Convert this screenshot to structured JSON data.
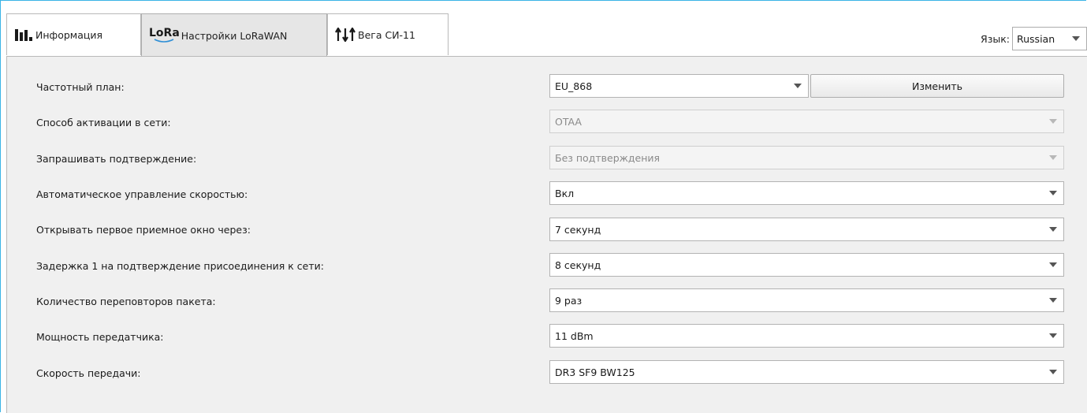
{
  "tabs": [
    {
      "label": "Информация",
      "icon": "bar-chart-icon"
    },
    {
      "label": "Настройки LoRaWAN",
      "icon": "lora-icon",
      "icon_text": "LoRa"
    },
    {
      "label": "Вега СИ-11",
      "icon": "arrows-settings-icon"
    }
  ],
  "language": {
    "label": "Язык:",
    "value": "Russian"
  },
  "change_button": "Изменить",
  "settings": [
    {
      "label": "Частотный план:",
      "value": "EU_868"
    },
    {
      "label": "Способ активации в сети:",
      "value": "OTAA"
    },
    {
      "label": "Запрашивать подтверждение:",
      "value": "Без подтверждения"
    },
    {
      "label": "Автоматическое управление скоростью:",
      "value": "Вкл"
    },
    {
      "label": "Открывать первое приемное окно через:",
      "value": "7 секунд"
    },
    {
      "label": "Задержка 1 на подтверждение присоединения к сети:",
      "value": "8 секунд"
    },
    {
      "label": "Количество переповторов пакета:",
      "value": "9 раз"
    },
    {
      "label": "Мощность передатчика:",
      "value": "11 dBm"
    },
    {
      "label": "Скорость передачи:",
      "value": "DR3 SF9 BW125"
    }
  ],
  "colors": {
    "accent": "#3ab4e6",
    "lora_blue": "#2f8fd6",
    "panel": "#f0f0f0"
  }
}
